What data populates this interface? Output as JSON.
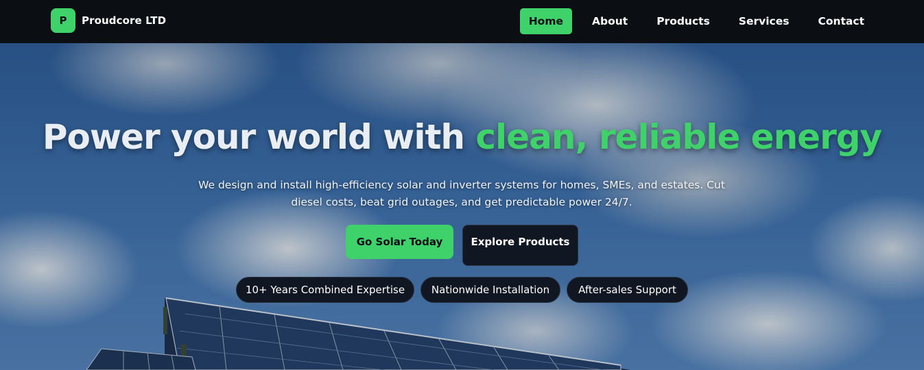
{
  "nav": {
    "logo_letter": "P",
    "brand_name": "Proudcore LTD",
    "links": [
      {
        "label": "Home",
        "active": true
      },
      {
        "label": "About",
        "active": false
      },
      {
        "label": "Products",
        "active": false
      },
      {
        "label": "Services",
        "active": false
      },
      {
        "label": "Contact",
        "active": false
      }
    ]
  },
  "hero": {
    "headline_plain": "Power your world with ",
    "headline_accent": "clean, reliable energy",
    "subtext": "We design and install high-efficiency solar and inverter systems for homes, SMEs, and estates. Cut diesel costs, beat grid outages, and get predictable power 24/7.",
    "primary_cta": "Go Solar Today",
    "secondary_cta": "Explore Products",
    "badges": [
      "10+ Years Combined Expertise",
      "Nationwide Installation",
      "After-sales Support"
    ]
  },
  "colors": {
    "accent": "#3fd16a",
    "nav_bg": "#0b0e13",
    "dark_button": "#111722"
  }
}
